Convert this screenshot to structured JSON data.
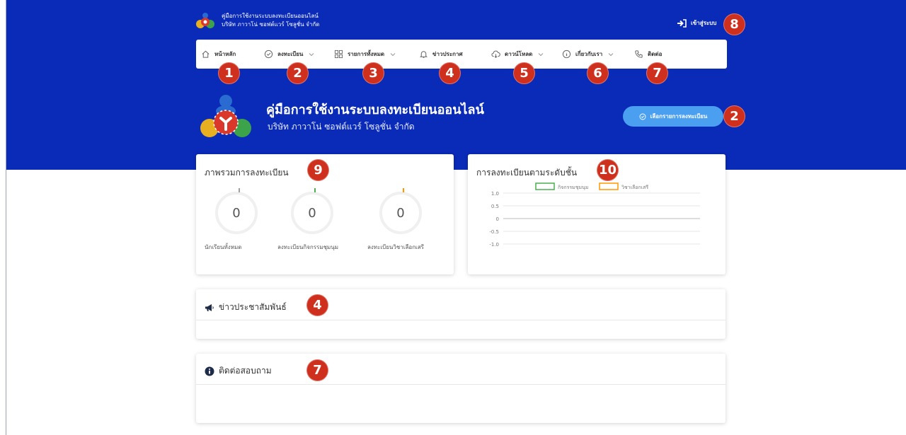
{
  "header": {
    "brand_line1": "คู่มือการใช้งานระบบลงทะเบียนออนไลน์",
    "brand_line2": "บริษัท ภาวาโน่ ซอฟต์แวร์ โซลูชั่น จำกัด",
    "login_label": "เข้าสู่ระบบ",
    "login_badge": "8"
  },
  "nav": {
    "items": [
      {
        "label": "หน้าหลัก",
        "icon": "home-icon",
        "badge": "1",
        "dropdown": false
      },
      {
        "label": "ลงทะเบียน",
        "icon": "check-circle-icon",
        "badge": "2",
        "dropdown": true
      },
      {
        "label": "รายการทั้งหมด",
        "icon": "grid-icon",
        "badge": "3",
        "dropdown": true
      },
      {
        "label": "ข่าวประกาศ",
        "icon": "bell-icon",
        "badge": "4",
        "dropdown": false
      },
      {
        "label": "ดาวน์โหลด",
        "icon": "cloud-download-icon",
        "badge": "5",
        "dropdown": true
      },
      {
        "label": "เกี่ยวกับเรา",
        "icon": "info-icon",
        "badge": "6",
        "dropdown": true
      },
      {
        "label": "ติดต่อ",
        "icon": "phone-icon",
        "badge": "7",
        "dropdown": false
      }
    ]
  },
  "hero": {
    "title": "คู่มือการใช้งานระบบลงทะเบียนออนไลน์",
    "subtitle": "บริษัท ภาวาโน่ ซอฟต์แวร์ โซลูชั่น จำกัด",
    "button_label": "เลือกรายการลงทะเบียน",
    "button_badge": "2"
  },
  "overview": {
    "title": "ภาพรวมการลงทะเบียน",
    "badge": "9",
    "stats": [
      {
        "value": "0",
        "label": "นักเรียนทั้งหมด",
        "color": "#9e9e9e"
      },
      {
        "value": "0",
        "label": "ลงทะเบียนกิจกรรมชุมนุม",
        "color": "#4caf50"
      },
      {
        "value": "0",
        "label": "ลงทะเบียนวิชาเลือกเสรี",
        "color": "#ff9800"
      }
    ]
  },
  "level_chart": {
    "title": "การลงทะเบียนตามระดับชั้น",
    "badge": "10"
  },
  "chart_data": {
    "type": "bar",
    "title": "การลงทะเบียนตามระดับชั้น",
    "series": [
      {
        "name": "กิจกรรมชุมนุม",
        "color": "#4caf50",
        "values": []
      },
      {
        "name": "วิชาเลือกเสรี",
        "color": "#ff9800",
        "values": []
      }
    ],
    "categories": [],
    "yticks": [
      "1.0",
      "0.5",
      "0",
      "-0.5",
      "-1.0"
    ],
    "ylim": [
      -1.0,
      1.0
    ],
    "legend": "top",
    "grid": true
  },
  "news": {
    "title": "ข่าวประชาสัมพันธ์",
    "badge": "4",
    "icon": "megaphone-icon"
  },
  "contact": {
    "title": "ติดต่อสอบถาม",
    "badge": "7",
    "icon": "info-circle-icon"
  },
  "colors": {
    "hero_bg": "#0a2ab8",
    "badge_red": "#cf2f1d",
    "button_blue": "#4a9ff0"
  }
}
